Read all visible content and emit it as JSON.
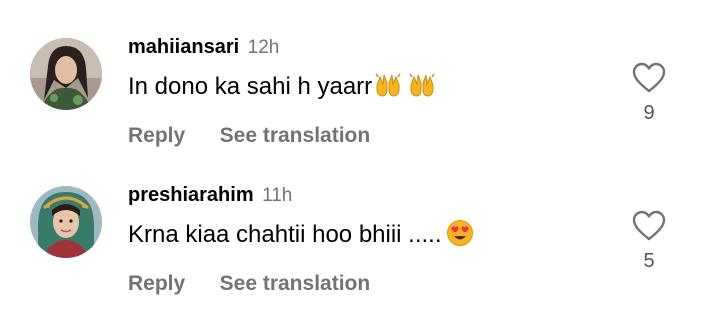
{
  "comments": [
    {
      "username": "mahiiansari",
      "timestamp": "12h",
      "text": "In dono ka sahi h yaarr",
      "emojis": [
        "raising-hands-emoji",
        "raising-hands-emoji"
      ],
      "reply_label": "Reply",
      "translate_label": "See translation",
      "like_count": "9"
    },
    {
      "username": "preshiarahim",
      "timestamp": "11h",
      "text": "Krna kiaa chahtii hoo bhiii .....",
      "emojis": [
        "heart-eyes-emoji"
      ],
      "reply_label": "Reply",
      "translate_label": "See translation",
      "like_count": "5"
    }
  ],
  "colors": {
    "secondary_text": "#737373",
    "emoji_yellow": "#F5B521",
    "heart_eyes_red": "#E8324A"
  }
}
